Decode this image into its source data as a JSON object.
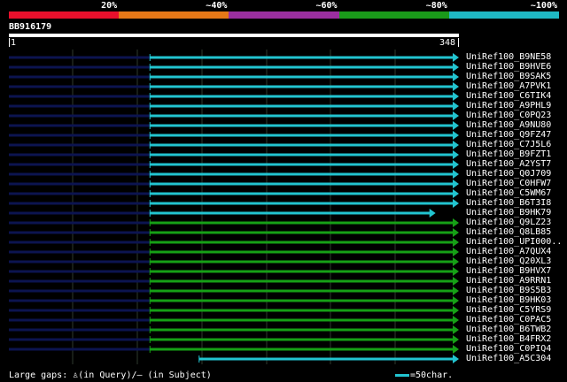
{
  "legend": {
    "segments": [
      {
        "label": "20%",
        "color": "#e8102c"
      },
      {
        "label": "~40%",
        "color": "#e67817"
      },
      {
        "label": "~60%",
        "color": "#9b2fa0"
      },
      {
        "label": "~80%",
        "color": "#1a9a1a"
      },
      {
        "label": "~100%",
        "color": "#1fb8c4"
      }
    ]
  },
  "query": {
    "id": "BB916179",
    "start": "1",
    "end": "348",
    "length": 348
  },
  "colors": {
    "cyan": "#22c4d0",
    "green": "#16a016",
    "navy": "#0c1450",
    "grid": "#2e3a2e"
  },
  "hits": [
    {
      "name": "UniRef100_B9NE58",
      "color": "cyan",
      "q_start": 1,
      "q_end": 348,
      "aligned_from": 110
    },
    {
      "name": "UniRef100_B9HVE6",
      "color": "cyan",
      "q_start": 1,
      "q_end": 348,
      "aligned_from": 110
    },
    {
      "name": "UniRef100_B9SAK5",
      "color": "cyan",
      "q_start": 1,
      "q_end": 348,
      "aligned_from": 110
    },
    {
      "name": "UniRef100_A7PVK1",
      "color": "cyan",
      "q_start": 1,
      "q_end": 348,
      "aligned_from": 110
    },
    {
      "name": "UniRef100_C6TIK4",
      "color": "cyan",
      "q_start": 1,
      "q_end": 348,
      "aligned_from": 110
    },
    {
      "name": "UniRef100_A9PHL9",
      "color": "cyan",
      "q_start": 1,
      "q_end": 348,
      "aligned_from": 110
    },
    {
      "name": "UniRef100_C0PQ23",
      "color": "cyan",
      "q_start": 1,
      "q_end": 348,
      "aligned_from": 110
    },
    {
      "name": "UniRef100_A9NU80",
      "color": "cyan",
      "q_start": 1,
      "q_end": 348,
      "aligned_from": 110
    },
    {
      "name": "UniRef100_Q9FZ47",
      "color": "cyan",
      "q_start": 1,
      "q_end": 348,
      "aligned_from": 110
    },
    {
      "name": "UniRef100_C7J5L6",
      "color": "cyan",
      "q_start": 1,
      "q_end": 348,
      "aligned_from": 110
    },
    {
      "name": "UniRef100_B9FZT1",
      "color": "cyan",
      "q_start": 1,
      "q_end": 348,
      "aligned_from": 110
    },
    {
      "name": "UniRef100_A2YST7",
      "color": "cyan",
      "q_start": 1,
      "q_end": 348,
      "aligned_from": 110
    },
    {
      "name": "UniRef100_Q0J709",
      "color": "cyan",
      "q_start": 1,
      "q_end": 348,
      "aligned_from": 110
    },
    {
      "name": "UniRef100_C0HFW7",
      "color": "cyan",
      "q_start": 1,
      "q_end": 348,
      "aligned_from": 110
    },
    {
      "name": "UniRef100_C5WM67",
      "color": "cyan",
      "q_start": 1,
      "q_end": 348,
      "aligned_from": 110
    },
    {
      "name": "UniRef100_B6T3I8",
      "color": "cyan",
      "q_start": 1,
      "q_end": 348,
      "aligned_from": 110
    },
    {
      "name": "UniRef100_B9HK79",
      "color": "cyan",
      "q_start": 1,
      "q_end": 330,
      "aligned_from": 110
    },
    {
      "name": "UniRef100_Q9LZ23",
      "color": "green",
      "q_start": 1,
      "q_end": 348,
      "aligned_from": 110
    },
    {
      "name": "UniRef100_Q8LB85",
      "color": "green",
      "q_start": 1,
      "q_end": 348,
      "aligned_from": 110
    },
    {
      "name": "UniRef100_UPI000..",
      "color": "green",
      "q_start": 1,
      "q_end": 348,
      "aligned_from": 110
    },
    {
      "name": "UniRef100_A7QUX4",
      "color": "green",
      "q_start": 1,
      "q_end": 348,
      "aligned_from": 110
    },
    {
      "name": "UniRef100_Q20XL3",
      "color": "green",
      "q_start": 1,
      "q_end": 348,
      "aligned_from": 110
    },
    {
      "name": "UniRef100_B9HVX7",
      "color": "green",
      "q_start": 1,
      "q_end": 348,
      "aligned_from": 110
    },
    {
      "name": "UniRef100_A9RRN1",
      "color": "green",
      "q_start": 1,
      "q_end": 348,
      "aligned_from": 110
    },
    {
      "name": "UniRef100_B9S5B3",
      "color": "green",
      "q_start": 1,
      "q_end": 348,
      "aligned_from": 110
    },
    {
      "name": "UniRef100_B9HK03",
      "color": "green",
      "q_start": 1,
      "q_end": 348,
      "aligned_from": 110
    },
    {
      "name": "UniRef100_C5YRS9",
      "color": "green",
      "q_start": 1,
      "q_end": 348,
      "aligned_from": 110
    },
    {
      "name": "UniRef100_C0PAC5",
      "color": "green",
      "q_start": 1,
      "q_end": 348,
      "aligned_from": 110
    },
    {
      "name": "UniRef100_B6TWB2",
      "color": "green",
      "q_start": 1,
      "q_end": 348,
      "aligned_from": 110
    },
    {
      "name": "UniRef100_B4FRX2",
      "color": "green",
      "q_start": 1,
      "q_end": 348,
      "aligned_from": 110
    },
    {
      "name": "UniRef100_C0PIQ4",
      "color": "green",
      "q_start": 1,
      "q_end": 348,
      "aligned_from": 110
    },
    {
      "name": "UniRef100_A5C304",
      "color": "cyan",
      "q_start": 148,
      "q_end": 348,
      "aligned_from": 148
    }
  ],
  "footer": {
    "gaps_text": "Large gaps: ♙(in Query)/– (in Subject)",
    "key_text": "=50char."
  }
}
